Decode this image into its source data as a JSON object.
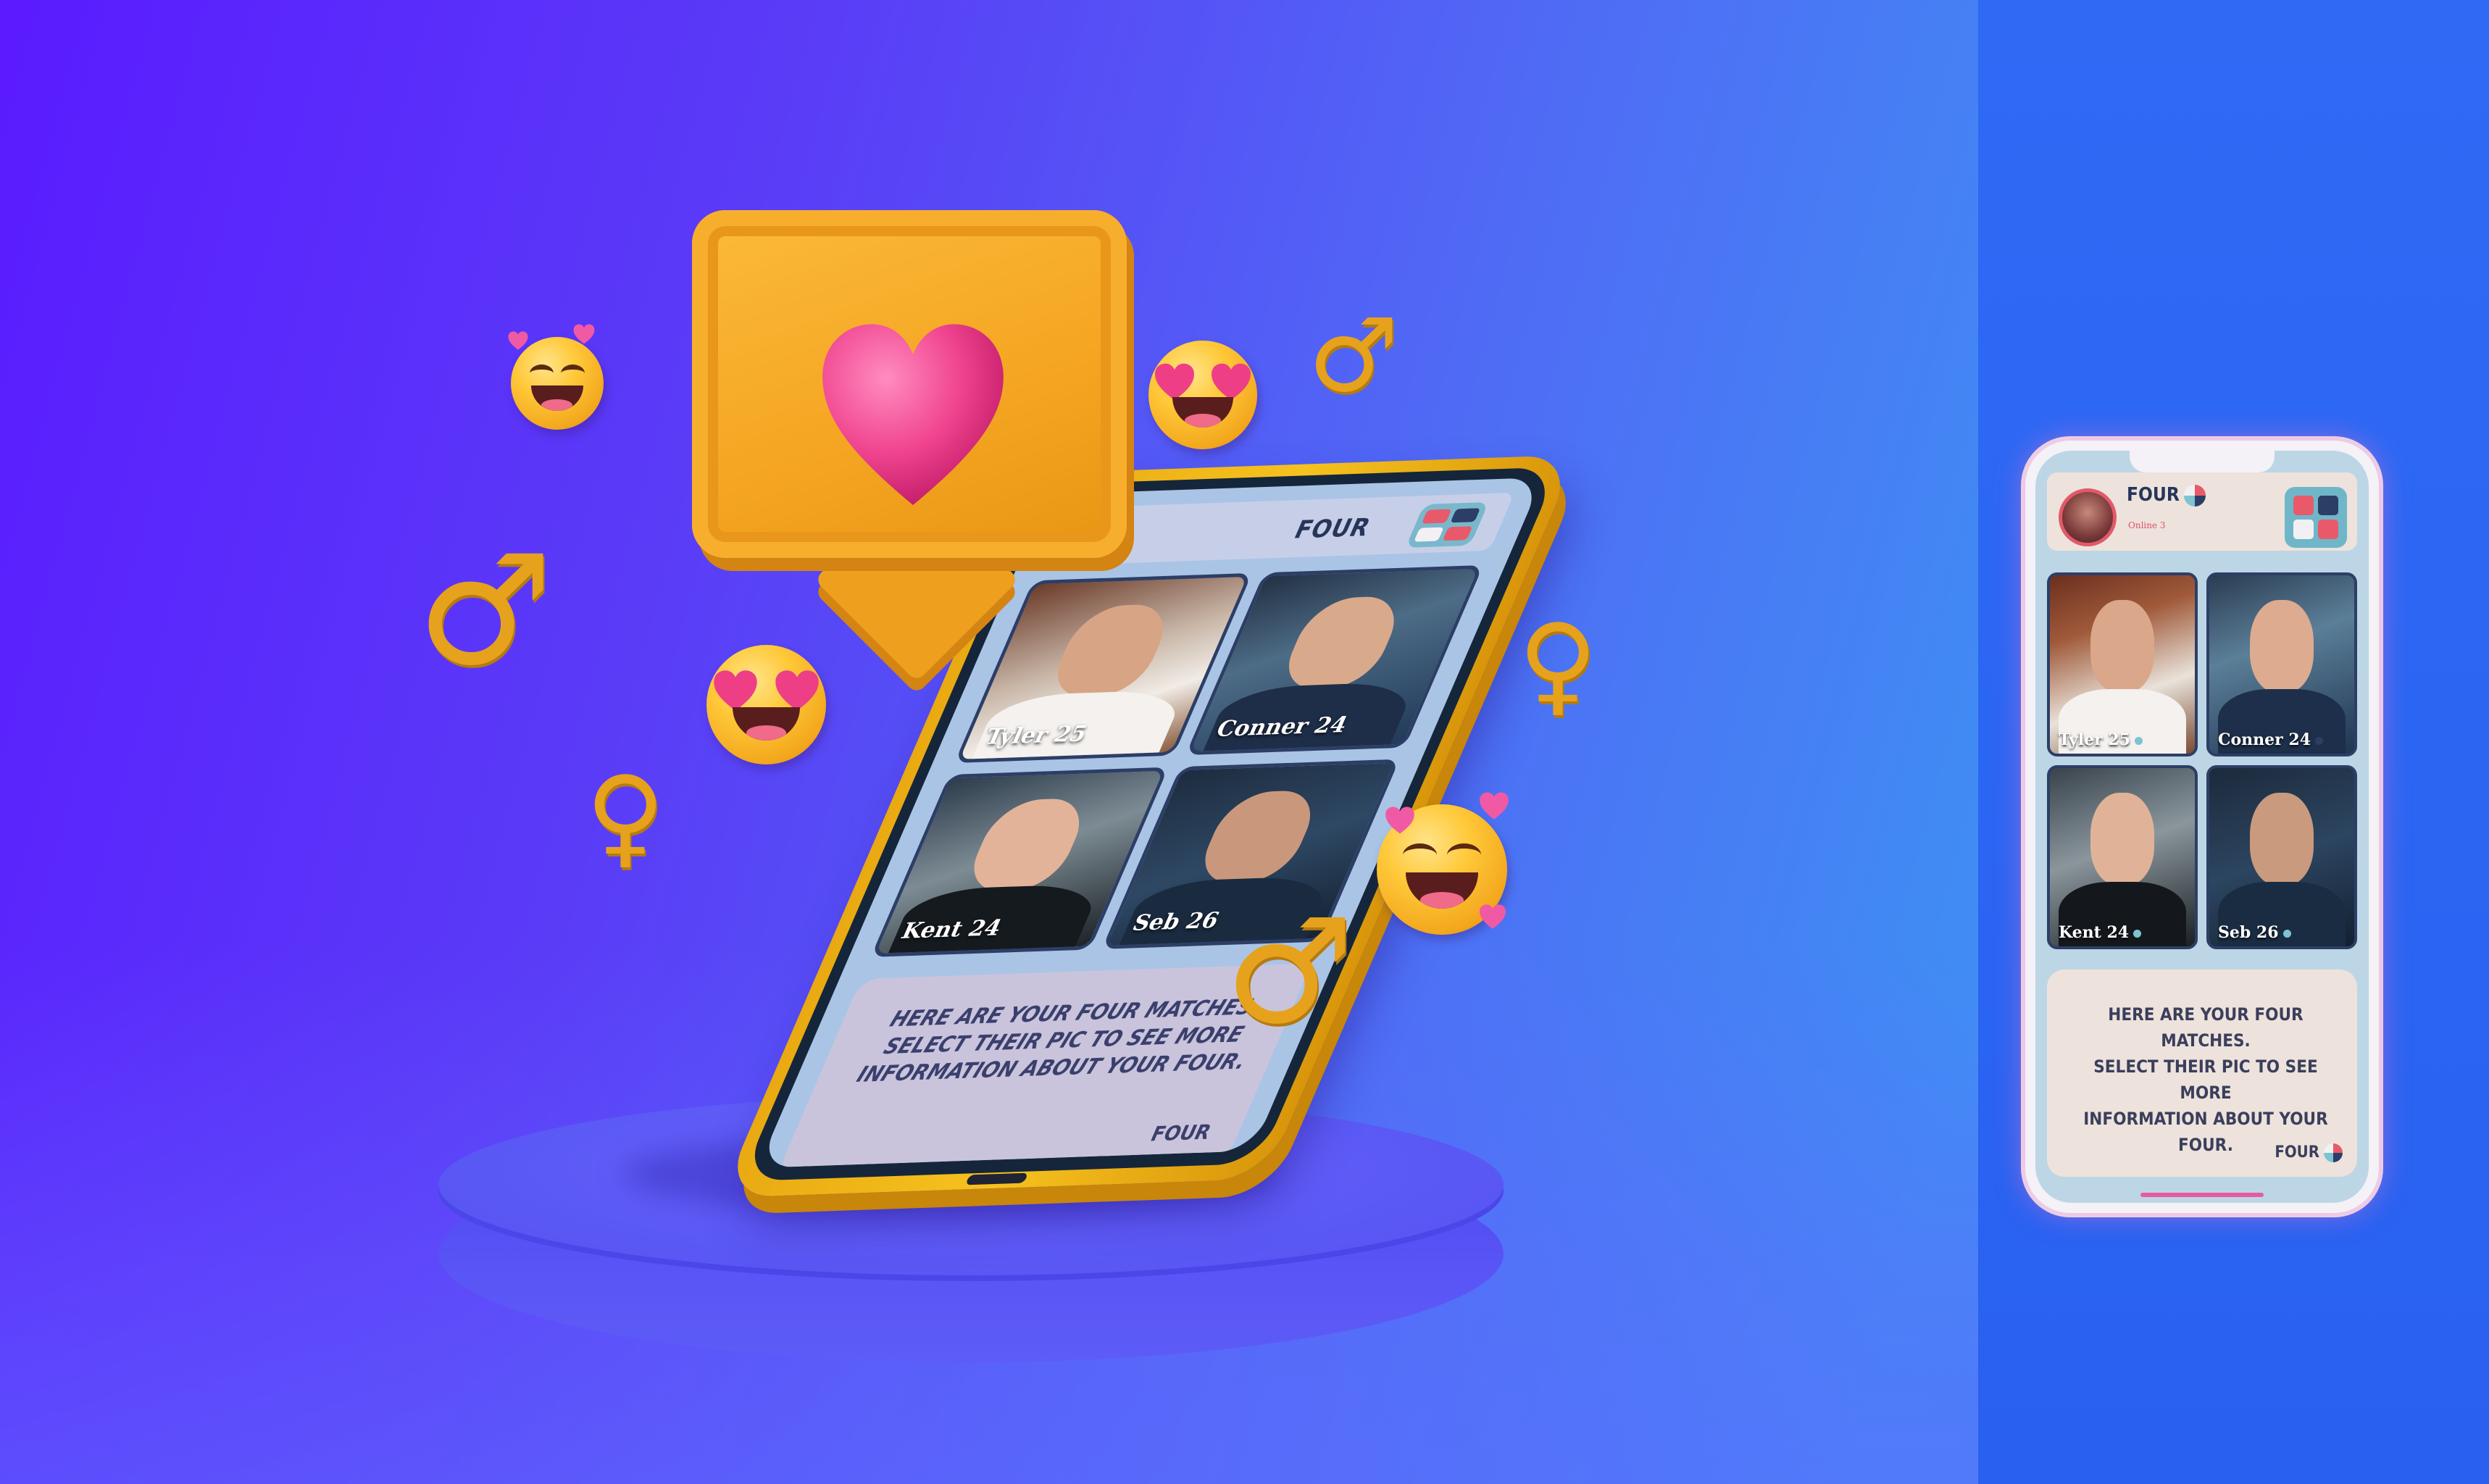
{
  "colors": {
    "bg_left": "#5a1bff",
    "bg_right": "#3b8ff2",
    "panel": "#2f6af5",
    "gold": "#f5a623",
    "heart": "#f0448f",
    "navy": "#2d3e66",
    "screen_cream": "#ede3dc"
  },
  "brand": "FOUR",
  "status": "Online 3",
  "matches": [
    {
      "name": "Tyler 25",
      "online_color": "#7ec3d2"
    },
    {
      "name": "Conner 24",
      "online_color": "#2d3e66"
    },
    {
      "name": "Kent 24",
      "online_color": "#7ec3d2"
    },
    {
      "name": "Seb 26",
      "online_color": "#7ec3d2"
    }
  ],
  "message": {
    "line1": "HERE ARE YOUR FOUR MATCHES.",
    "line2": "SELECT THEIR PIC TO SEE MORE",
    "line3": "INFORMATION ABOUT YOUR FOUR."
  },
  "icons": [
    "heart-icon",
    "male-symbol-icon",
    "female-symbol-icon",
    "smiling-emoji-icon",
    "heart-eyes-emoji-icon",
    "app-grid-icon",
    "logo-dot-icon"
  ]
}
